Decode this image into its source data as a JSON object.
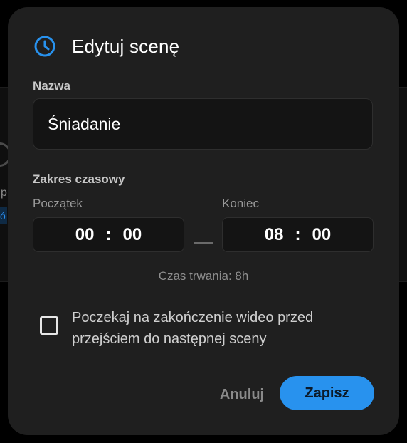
{
  "background": {
    "ghost_text": "p",
    "ghost_chip_text": "ó"
  },
  "dialog": {
    "title": "Edytuj scenę",
    "icon": "clock-icon",
    "accent_color": "#2892ee",
    "name_label": "Nazwa",
    "name_value": "Śniadanie",
    "time_range_label": "Zakres czasowy",
    "start": {
      "label": "Początek",
      "hours": "00",
      "minutes": "00"
    },
    "end": {
      "label": "Koniec",
      "hours": "08",
      "minutes": "00"
    },
    "time_separator": ":",
    "duration_text": "Czas trwania: 8h",
    "wait_checkbox": {
      "checked": false,
      "label": "Poczekaj na zakończenie wideo przed przejściem do następnej sceny"
    },
    "cancel_label": "Anuluj",
    "save_label": "Zapisz"
  }
}
